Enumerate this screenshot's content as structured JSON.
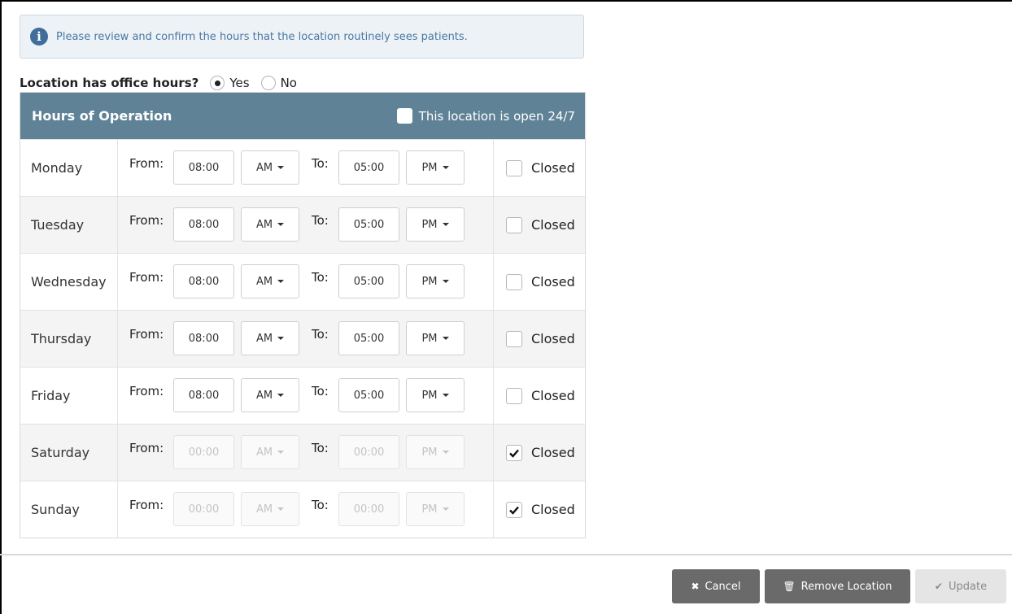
{
  "info": {
    "text": "Please review and confirm the hours that the location routinely sees patients.",
    "icon": "info-circle-icon"
  },
  "office_hours": {
    "label": "Location has office hours?",
    "yes_label": "Yes",
    "no_label": "No",
    "selected": "Yes"
  },
  "hours": {
    "title": "Hours of Operation",
    "open247_label": "This location is open 24/7",
    "from_label": "From:",
    "to_label": "To:",
    "closed_label": "Closed",
    "days": [
      {
        "name": "Monday",
        "from": "08:00",
        "from_ampm": "AM",
        "to": "05:00",
        "to_ampm": "PM",
        "closed": false
      },
      {
        "name": "Tuesday",
        "from": "08:00",
        "from_ampm": "AM",
        "to": "05:00",
        "to_ampm": "PM",
        "closed": false
      },
      {
        "name": "Wednesday",
        "from": "08:00",
        "from_ampm": "AM",
        "to": "05:00",
        "to_ampm": "PM",
        "closed": false
      },
      {
        "name": "Thursday",
        "from": "08:00",
        "from_ampm": "AM",
        "to": "05:00",
        "to_ampm": "PM",
        "closed": false
      },
      {
        "name": "Friday",
        "from": "08:00",
        "from_ampm": "AM",
        "to": "05:00",
        "to_ampm": "PM",
        "closed": false
      },
      {
        "name": "Saturday",
        "from": "00:00",
        "from_ampm": "AM",
        "to": "00:00",
        "to_ampm": "PM",
        "closed": true
      },
      {
        "name": "Sunday",
        "from": "00:00",
        "from_ampm": "AM",
        "to": "00:00",
        "to_ampm": "PM",
        "closed": true
      }
    ]
  },
  "footer": {
    "cancel_label": "Cancel",
    "remove_label": "Remove Location",
    "update_label": "Update"
  },
  "colors": {
    "header_bg": "#5f8296",
    "info_bg": "#edf2f6",
    "info_text": "#4a77a3",
    "button_bg": "#6a6a6a"
  }
}
